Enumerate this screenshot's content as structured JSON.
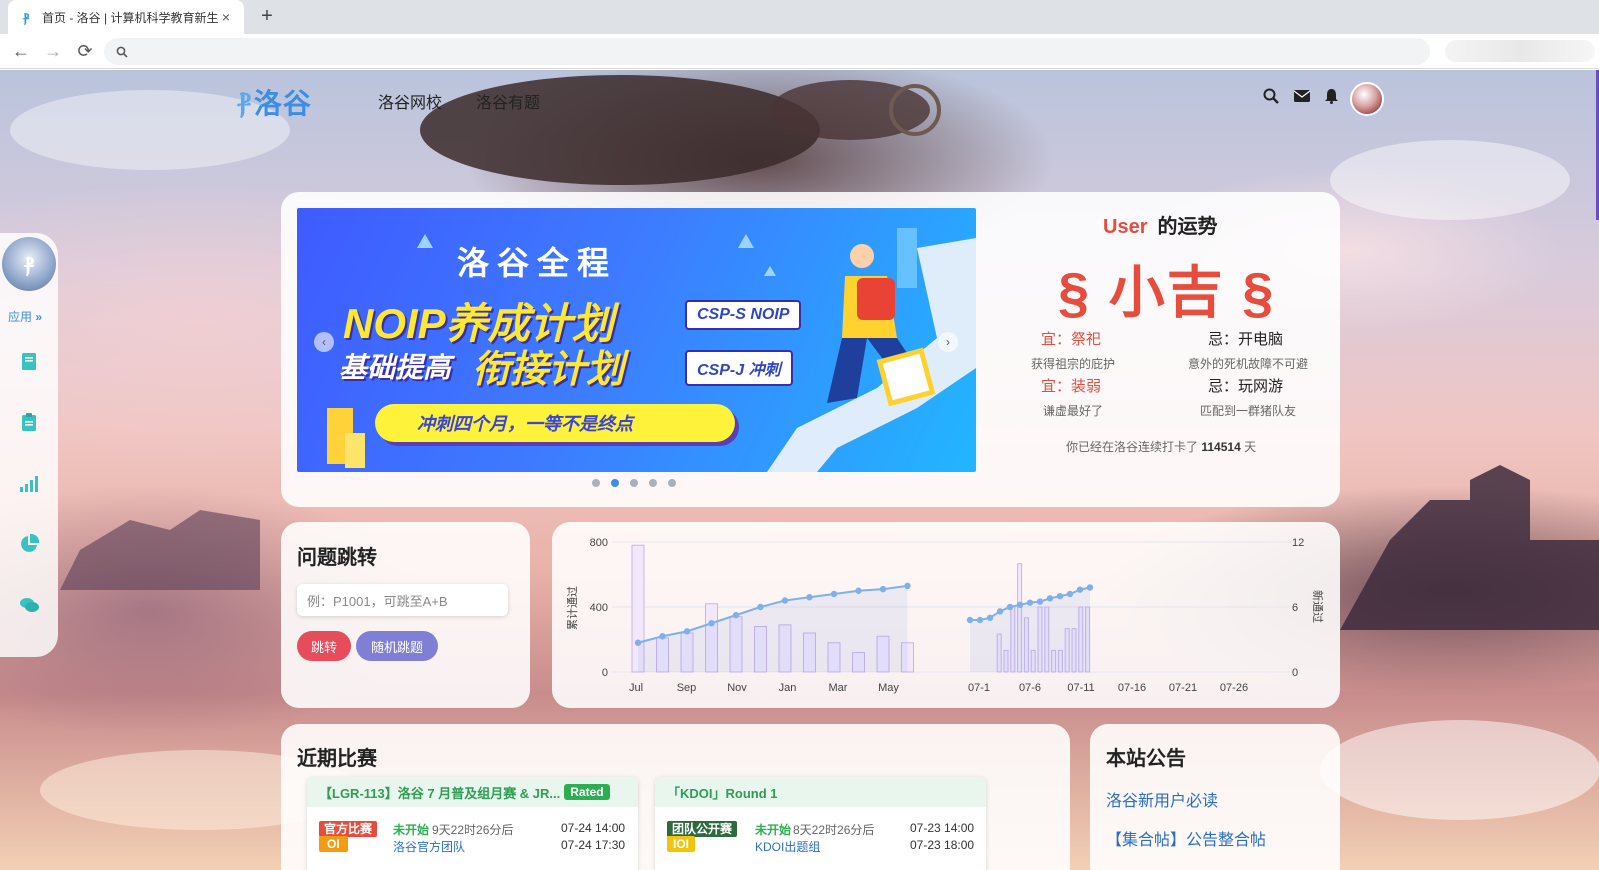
{
  "browser": {
    "tab_title": "首页 - 洛谷 | 计算机科学教育新生",
    "tab_close": "×",
    "new_tab": "+",
    "back": "←",
    "forward": "→",
    "reload": "⟳",
    "search_icon": "🔍"
  },
  "site": {
    "logo_text": "洛谷",
    "nav": [
      "洛谷网校",
      "洛谷有题"
    ],
    "icons": [
      "search-icon",
      "mail-icon",
      "bell-icon",
      "avatar"
    ]
  },
  "sidebar": {
    "app_label": "应用",
    "app_arrow": "»",
    "icons": [
      "book-icon",
      "clipboard-icon",
      "signal-icon",
      "pie-chart-icon",
      "chat-icon"
    ]
  },
  "banner": {
    "title": "洛谷全程",
    "line1": "NOIP养成计划",
    "line2a": "基础提高",
    "line2b": "衔接计划",
    "tag1": "CSP-S NOIP",
    "tag2": "CSP-J 冲刺",
    "slogan": "冲刺四个月，一等不是终点",
    "prev": "‹",
    "next": "›",
    "dots": 5,
    "active_dot": 1
  },
  "fortune": {
    "user": "User",
    "suffix": "的运势",
    "result": "§ 小吉 §",
    "good1": "宜：祭祀",
    "good1_sub": "获得祖宗的庇护",
    "bad1": "忌：开电脑",
    "bad1_sub": "意外的死机故障不可避",
    "good2": "宜：装弱",
    "good2_sub": "谦虚最好了",
    "bad2": "忌：玩网游",
    "bad2_sub": "匹配到一群猪队友",
    "checkin_prefix": "你已经在洛谷连续打卡了",
    "checkin_days": "114514",
    "checkin_suffix": "天"
  },
  "jump": {
    "title": "问题跳转",
    "placeholder": "例：P1001，可跳至A+B",
    "go": "跳转",
    "random": "随机跳题"
  },
  "chart_data": [
    {
      "type": "bar",
      "ylabel": "累计通过",
      "ylim": [
        0,
        800
      ],
      "yticks": [
        "800",
        "400",
        "0"
      ],
      "x_ticks": [
        "Jul",
        "Sep",
        "Nov",
        "Jan",
        "Mar",
        "May"
      ],
      "bars": [
        780,
        210,
        240,
        420,
        340,
        280,
        290,
        240,
        180,
        120,
        220,
        180
      ],
      "line": [
        180,
        220,
        250,
        300,
        350,
        400,
        440,
        460,
        480,
        500,
        510,
        530
      ]
    },
    {
      "type": "bar",
      "ylabel": "新通过",
      "ylim": [
        0,
        12
      ],
      "yticks": [
        "12",
        "6",
        "0"
      ],
      "x_ticks": [
        "07-1",
        "07-6",
        "07-11",
        "07-16",
        "07-21",
        "07-26"
      ],
      "bars": [
        0,
        0,
        0,
        0,
        3.5,
        2,
        6,
        10,
        5,
        2,
        6,
        6,
        2,
        2,
        4,
        4,
        6,
        6
      ],
      "line": [
        4.8,
        4.8,
        5,
        5.6,
        6,
        6.2,
        6.4,
        6.5,
        6.8,
        7,
        7.2,
        7.6,
        7.8
      ]
    }
  ],
  "contests": {
    "title": "近期比赛",
    "items": [
      {
        "name": "【LGR-113】洛谷 7 月普及组月赛 & JR...",
        "badge": "Rated",
        "tag1": "官方比赛",
        "tag1_color": "#e74c3c",
        "tag2": "OI",
        "tag2_color": "#f39c12",
        "status": "未开始",
        "countdown": "9天22时26分后",
        "host": "洛谷官方团队",
        "start": "07-24 14:00",
        "end": "07-24 17:30"
      },
      {
        "name": "「KDOI」Round 1",
        "badge": "",
        "tag1": "团队公开赛",
        "tag1_color": "#2e6b3c",
        "tag2": "IOI",
        "tag2_color": "#f1c40f",
        "status": "未开始",
        "countdown": "8天22时26分后",
        "host": "KDOI出题组",
        "start": "07-23 14:00",
        "end": "07-23 18:00"
      }
    ]
  },
  "notices": {
    "title": "本站公告",
    "items": [
      "洛谷新用户必读",
      "【集合帖】公告整合帖"
    ]
  },
  "colors": {
    "accent": "#3a8ee6",
    "red": "#e74c3c",
    "green": "#2eae52",
    "purple_btn": "#7f7fd5"
  }
}
